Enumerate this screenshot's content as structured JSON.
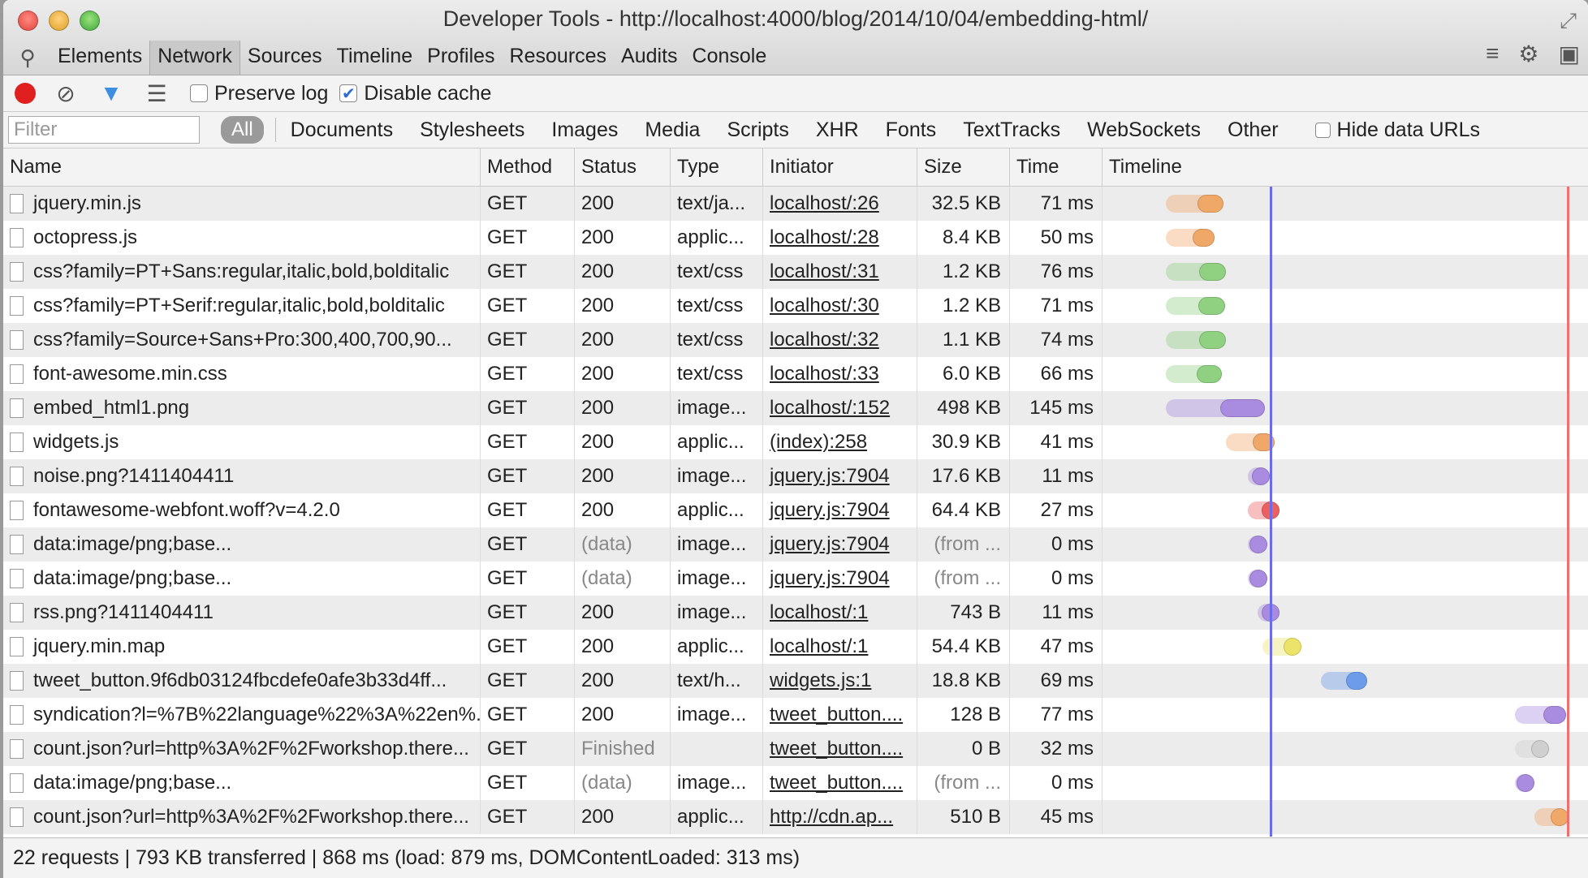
{
  "window": {
    "title": "Developer Tools - http://localhost:4000/blog/2014/10/04/embedding-html/"
  },
  "tabs": [
    "Elements",
    "Network",
    "Sources",
    "Timeline",
    "Profiles",
    "Resources",
    "Audits",
    "Console"
  ],
  "active_tab": "Network",
  "toolbar": {
    "preserve_log": "Preserve log",
    "disable_cache": "Disable cache"
  },
  "filter": {
    "placeholder": "Filter",
    "all_label": "All",
    "types": [
      "Documents",
      "Stylesheets",
      "Images",
      "Media",
      "Scripts",
      "XHR",
      "Fonts",
      "TextTracks",
      "WebSockets",
      "Other"
    ],
    "hide_data_urls": "Hide data URLs"
  },
  "columns": {
    "name": "Name",
    "method": "Method",
    "status": "Status",
    "type": "Type",
    "initiator": "Initiator",
    "size": "Size",
    "time": "Time",
    "timeline": "Timeline"
  },
  "colors": {
    "orange": "#f0a868",
    "green": "#8fd081",
    "purple": "#a98be0",
    "red": "#ec6060",
    "blue": "#6d9cea",
    "yellow": "#ece46a",
    "gray": "#cfcfcf",
    "dom_line": "#6b6bf0",
    "load_line": "#f07070"
  },
  "timeline_markers": {
    "dom_content_loaded_fraction": 0.345,
    "load_fraction": 0.957
  },
  "requests": [
    {
      "name": "jquery.min.js",
      "method": "GET",
      "status": "200",
      "type": "text/ja...",
      "initiator": "localhost/:26",
      "size": "32.5 KB",
      "time": "71 ms",
      "bar_start": 0.13,
      "bar_end": 0.25,
      "color": "orange"
    },
    {
      "name": "octopress.js",
      "method": "GET",
      "status": "200",
      "type": "applic...",
      "initiator": "localhost/:28",
      "size": "8.4 KB",
      "time": "50 ms",
      "bar_start": 0.13,
      "bar_end": 0.23,
      "color": "orange"
    },
    {
      "name": "css?family=PT+Sans:regular,italic,bold,bolditalic",
      "method": "GET",
      "status": "200",
      "type": "text/css",
      "initiator": "localhost/:31",
      "size": "1.2 KB",
      "time": "76 ms",
      "bar_start": 0.13,
      "bar_end": 0.255,
      "color": "green"
    },
    {
      "name": "css?family=PT+Serif:regular,italic,bold,bolditalic",
      "method": "GET",
      "status": "200",
      "type": "text/css",
      "initiator": "localhost/:30",
      "size": "1.2 KB",
      "time": "71 ms",
      "bar_start": 0.13,
      "bar_end": 0.253,
      "color": "green"
    },
    {
      "name": "css?family=Source+Sans+Pro:300,400,700,90...",
      "method": "GET",
      "status": "200",
      "type": "text/css",
      "initiator": "localhost/:32",
      "size": "1.1 KB",
      "time": "74 ms",
      "bar_start": 0.13,
      "bar_end": 0.255,
      "color": "green"
    },
    {
      "name": "font-awesome.min.css",
      "method": "GET",
      "status": "200",
      "type": "text/css",
      "initiator": "localhost/:33",
      "size": "6.0 KB",
      "time": "66 ms",
      "bar_start": 0.13,
      "bar_end": 0.245,
      "color": "green"
    },
    {
      "name": "embed_html1.png",
      "method": "GET",
      "status": "200",
      "type": "image...",
      "initiator": "localhost/:152",
      "size": "498 KB",
      "time": "145 ms",
      "bar_start": 0.13,
      "bar_end": 0.335,
      "color": "purple"
    },
    {
      "name": "widgets.js",
      "method": "GET",
      "status": "200",
      "type": "applic...",
      "initiator": "(index):258",
      "size": "30.9 KB",
      "time": "41 ms",
      "bar_start": 0.255,
      "bar_end": 0.355,
      "color": "orange"
    },
    {
      "name": "noise.png?1411404411",
      "method": "GET",
      "status": "200",
      "type": "image...",
      "initiator": "jquery.js:7904",
      "size": "17.6 KB",
      "time": "11 ms",
      "bar_start": 0.3,
      "bar_end": 0.345,
      "color": "purple"
    },
    {
      "name": "fontawesome-webfont.woff?v=4.2.0",
      "method": "GET",
      "status": "200",
      "type": "applic...",
      "initiator": "jquery.js:7904",
      "size": "64.4 KB",
      "time": "27 ms",
      "bar_start": 0.3,
      "bar_end": 0.365,
      "color": "red"
    },
    {
      "name": "data:image/png;base...",
      "method": "GET",
      "status": "(data)",
      "type": "image...",
      "initiator": "jquery.js:7904",
      "size": "(from ...",
      "time": "0 ms",
      "bar_start": 0.3,
      "bar_end": 0.34,
      "color": "purple"
    },
    {
      "name": "data:image/png;base...",
      "method": "GET",
      "status": "(data)",
      "type": "image...",
      "initiator": "jquery.js:7904",
      "size": "(from ...",
      "time": "0 ms",
      "bar_start": 0.3,
      "bar_end": 0.34,
      "color": "purple"
    },
    {
      "name": "rss.png?1411404411",
      "method": "GET",
      "status": "200",
      "type": "image...",
      "initiator": "localhost/:1",
      "size": "743 B",
      "time": "11 ms",
      "bar_start": 0.32,
      "bar_end": 0.365,
      "color": "purple"
    },
    {
      "name": "jquery.min.map",
      "method": "GET",
      "status": "200",
      "type": "applic...",
      "initiator": "localhost/:1",
      "size": "54.4 KB",
      "time": "47 ms",
      "bar_start": 0.33,
      "bar_end": 0.41,
      "color": "yellow"
    },
    {
      "name": "tweet_button.9f6db03124fbcdefe0afe3b33d4ff...",
      "method": "GET",
      "status": "200",
      "type": "text/h...",
      "initiator": "widgets.js:1",
      "size": "18.8 KB",
      "time": "69 ms",
      "bar_start": 0.45,
      "bar_end": 0.545,
      "color": "blue"
    },
    {
      "name": "syndication?l=%7B%22language%22%3A%22en%...",
      "method": "GET",
      "status": "200",
      "type": "image...",
      "initiator": "tweet_button....",
      "size": "128 B",
      "time": "77 ms",
      "bar_start": 0.85,
      "bar_end": 0.955,
      "color": "purple"
    },
    {
      "name": "count.json?url=http%3A%2F%2Fworkshop.there...",
      "method": "GET",
      "status": "Finished",
      "type": "",
      "initiator": "tweet_button....",
      "size": "0 B",
      "time": "32 ms",
      "bar_start": 0.85,
      "bar_end": 0.92,
      "color": "gray"
    },
    {
      "name": "data:image/png;base...",
      "method": "GET",
      "status": "(data)",
      "type": "image...",
      "initiator": "tweet_button....",
      "size": "(from ...",
      "time": "0 ms",
      "bar_start": 0.85,
      "bar_end": 0.89,
      "color": "purple"
    },
    {
      "name": "count.json?url=http%3A%2F%2Fworkshop.there...",
      "method": "GET",
      "status": "200",
      "type": "applic...",
      "initiator": "http://cdn.ap...",
      "size": "510 B",
      "time": "45 ms",
      "bar_start": 0.89,
      "bar_end": 0.96,
      "color": "orange"
    }
  ],
  "summary": "22 requests | 793 KB transferred | 868 ms (load: 879 ms, DOMContentLoaded: 313 ms)"
}
